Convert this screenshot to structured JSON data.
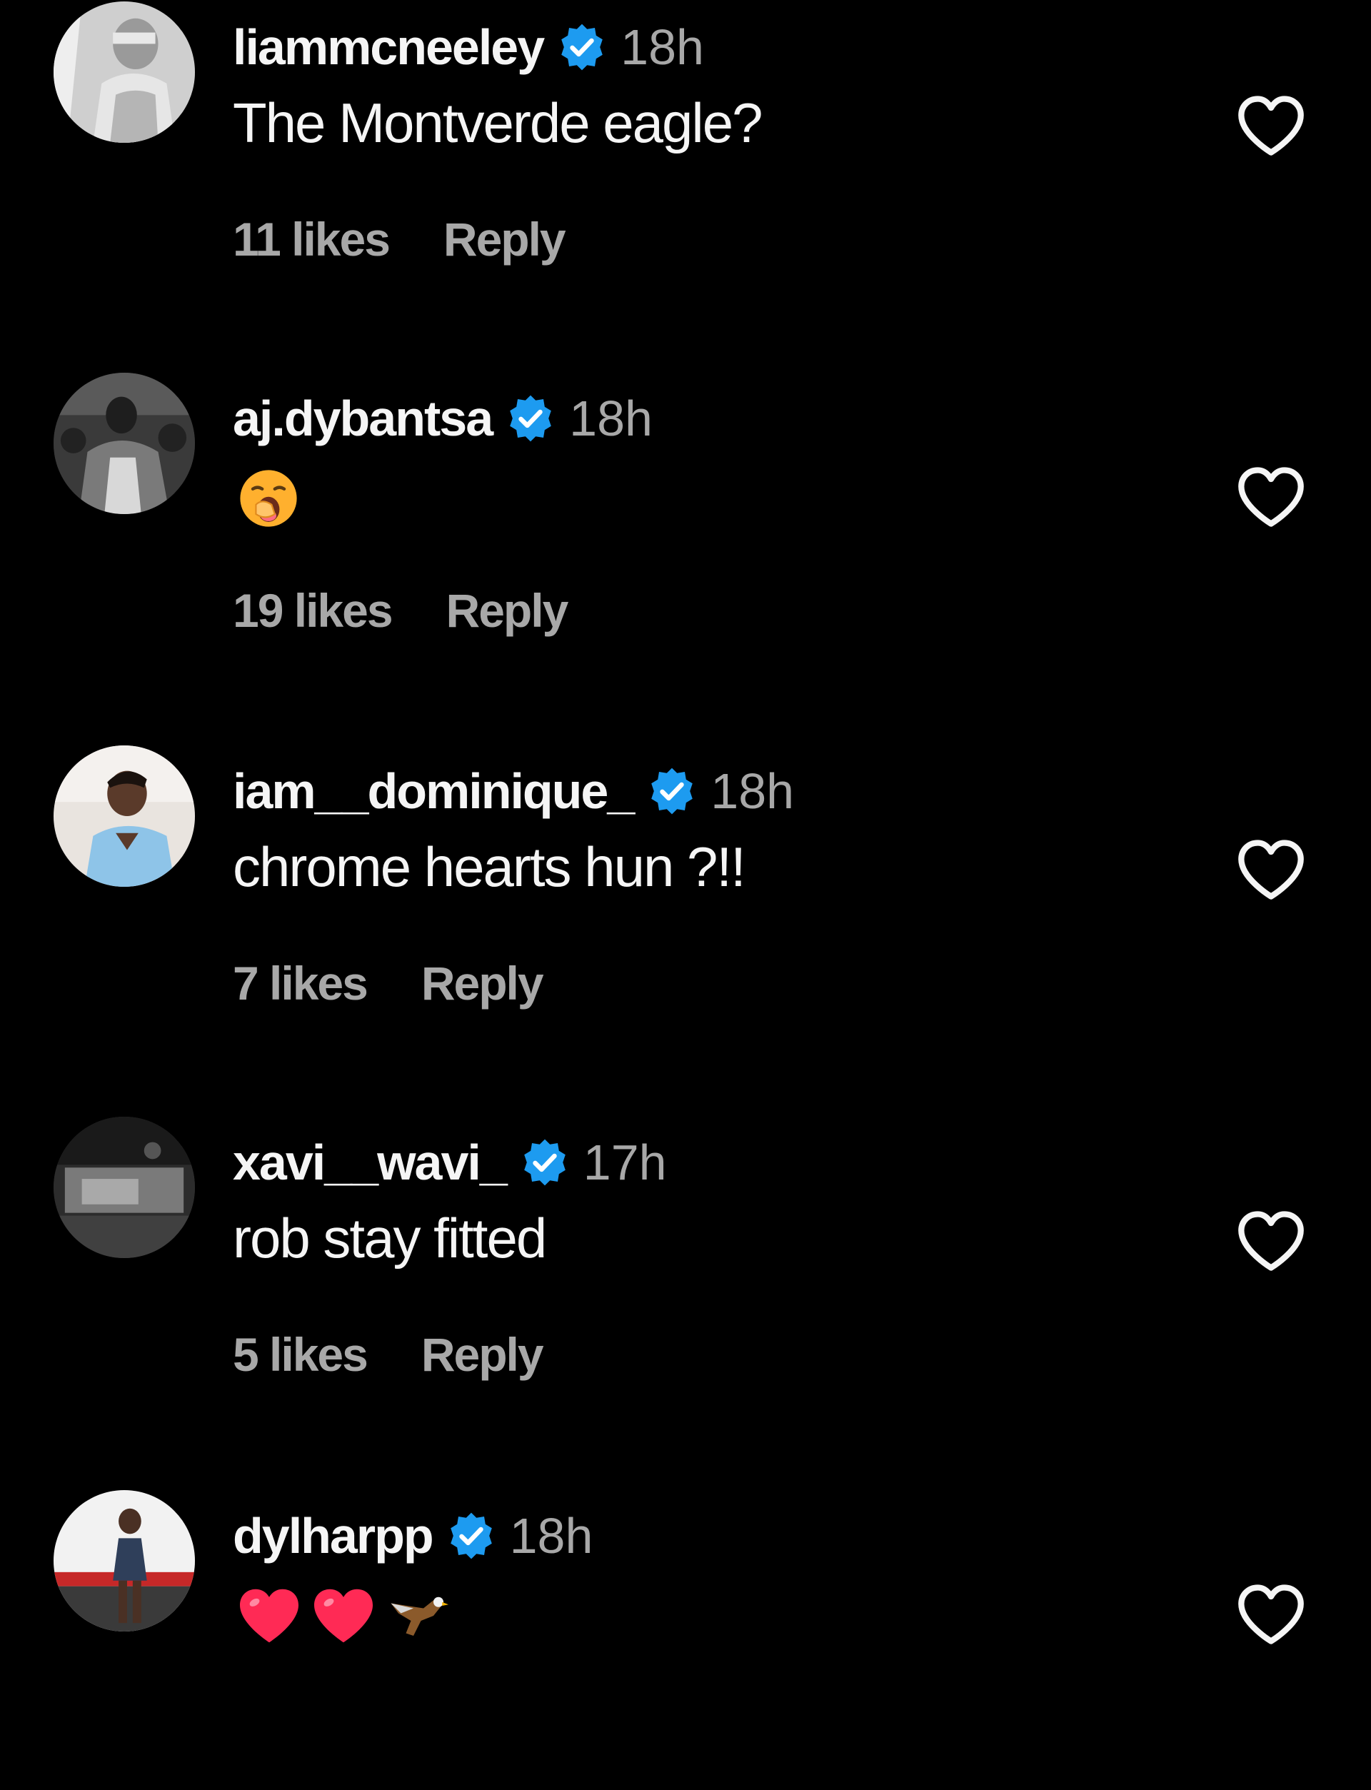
{
  "colors": {
    "background": "#000000",
    "primary_text": "#f5f5f5",
    "secondary_text": "#a8a8a8",
    "verified_badge": "#1d9bf0"
  },
  "comments": [
    {
      "username": "liammcneeley",
      "verified": true,
      "time": "18h",
      "text": "The Montverde eagle?",
      "likes": "11 likes",
      "reply_label": "Reply",
      "like_icon": "heart-outline-icon"
    },
    {
      "username": "aj.dybantsa",
      "verified": true,
      "time": "18h",
      "text": "",
      "emojis": [
        "yawning-face-emoji"
      ],
      "likes": "19 likes",
      "reply_label": "Reply",
      "like_icon": "heart-outline-icon"
    },
    {
      "username": "iam__dominique_",
      "verified": true,
      "time": "18h",
      "text": "chrome hearts hun ?!!",
      "likes": "7 likes",
      "reply_label": "Reply",
      "like_icon": "heart-outline-icon"
    },
    {
      "username": "xavi__wavi_",
      "verified": true,
      "time": "17h",
      "text": "rob stay fitted",
      "likes": "5 likes",
      "reply_label": "Reply",
      "like_icon": "heart-outline-icon"
    },
    {
      "username": "dylharpp",
      "verified": true,
      "time": "18h",
      "text": "",
      "emojis": [
        "red-heart-emoji",
        "red-heart-emoji",
        "eagle-emoji"
      ],
      "like_icon": "heart-outline-icon"
    }
  ]
}
